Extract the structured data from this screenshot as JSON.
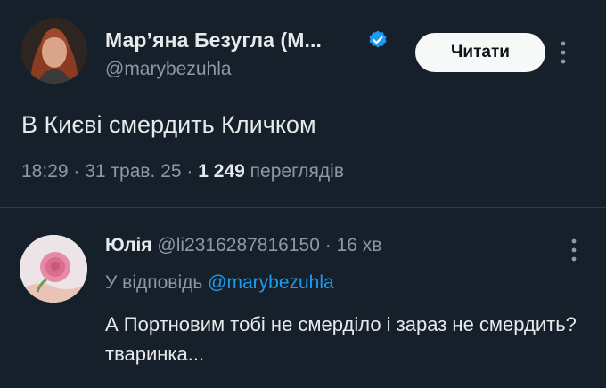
{
  "tweet": {
    "author_name": "Мар’яна Безугла (М...",
    "author_handle": "@marybezuhla",
    "follow_label": "Читати",
    "text": "В Києві смердить Кличком",
    "time": "18:29",
    "sep1": " · ",
    "date": "31 трав. 25",
    "sep2": " · ",
    "views_count": "1 249",
    "views_label": " переглядів"
  },
  "reply": {
    "name": "Юлія",
    "handle": "@li2316287816150",
    "dot": " · ",
    "time": "16 хв",
    "reply_to_label": "У відповідь ",
    "reply_to_handle": "@marybezuhla",
    "text": "А Портновим тобі не смерділо і зараз не смердить? тваринка..."
  },
  "colors": {
    "background": "#15202b",
    "accent": "#1d9bf0",
    "secondary_text": "#8b98a5",
    "primary_text": "#e7e9ea"
  },
  "icons": {
    "verified": "verified-badge-icon",
    "more": "more-vertical-icon"
  }
}
